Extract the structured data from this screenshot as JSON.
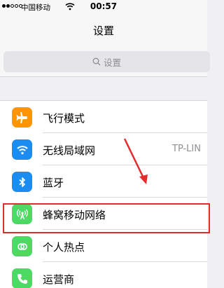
{
  "status_bar": {
    "carrier": "中国移动",
    "time": "00:57"
  },
  "nav": {
    "title": "设置"
  },
  "search": {
    "placeholder": "设置"
  },
  "settings": [
    {
      "label": "飞行模式",
      "icon": "airplane-icon",
      "color": "#ff9500"
    },
    {
      "label": "无线局域网",
      "value": "TP-LIN",
      "icon": "wifi-icon",
      "color": "#1a8cf2"
    },
    {
      "label": "蓝牙",
      "icon": "bluetooth-icon",
      "color": "#1a8cf2"
    },
    {
      "label": "蜂窝移动网络",
      "icon": "cellular-antenna-icon",
      "color": "#4cd964"
    },
    {
      "label": "个人热点",
      "icon": "hotspot-icon",
      "color": "#4cd964"
    },
    {
      "label": "运营商",
      "icon": "phone-icon",
      "color": "#4cd964"
    }
  ],
  "annotation": {
    "highlight_color": "#e32d2d"
  }
}
